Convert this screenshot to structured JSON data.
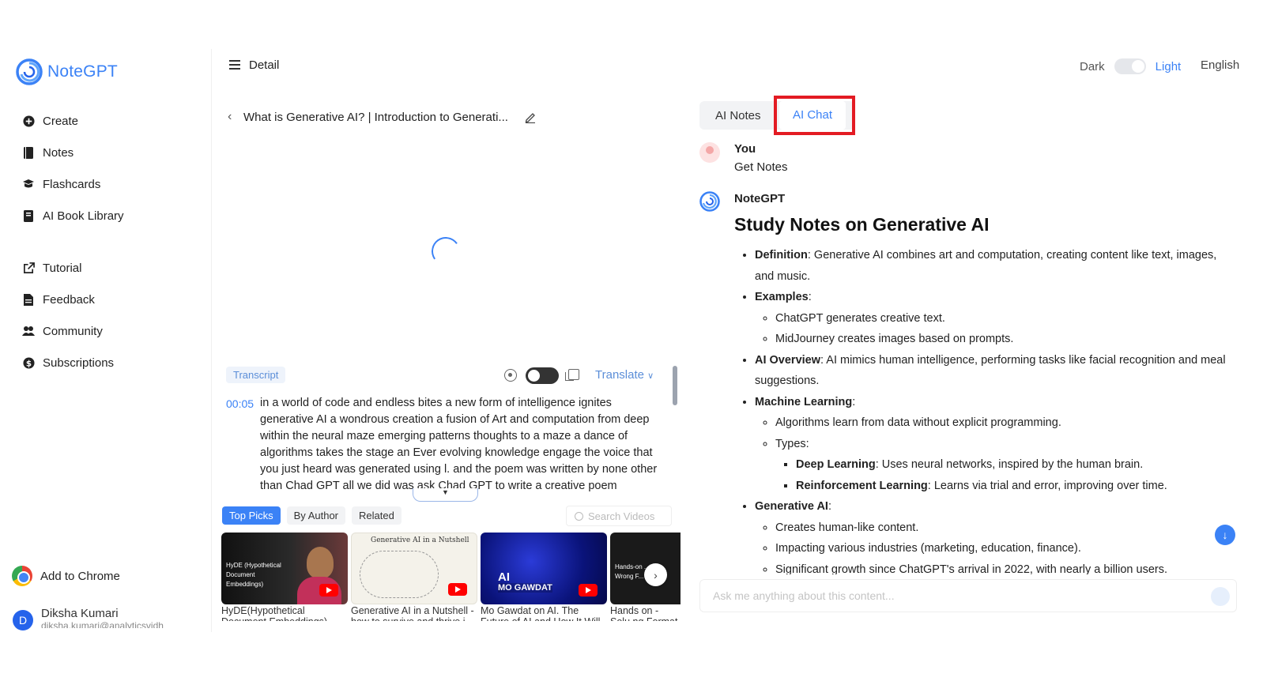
{
  "app": {
    "name": "NoteGPT"
  },
  "sidebar": {
    "primary": [
      {
        "label": "Create",
        "icon": "plus-circle-icon"
      },
      {
        "label": "Notes",
        "icon": "book-icon"
      },
      {
        "label": "Flashcards",
        "icon": "flashcards-icon"
      },
      {
        "label": "AI Book Library",
        "icon": "library-icon"
      }
    ],
    "secondary": [
      {
        "label": "Tutorial",
        "icon": "external-link-icon"
      },
      {
        "label": "Feedback",
        "icon": "document-icon"
      },
      {
        "label": "Community",
        "icon": "community-icon"
      },
      {
        "label": "Subscriptions",
        "icon": "dollar-icon"
      }
    ],
    "add_to_chrome": "Add to Chrome",
    "user": {
      "initial": "D",
      "name": "Diksha Kumari",
      "email": "diksha.kumari@analyticsvidh"
    }
  },
  "header": {
    "title": "Detail",
    "theme_dark": "Dark",
    "theme_light": "Light",
    "language": "English"
  },
  "video": {
    "title": "What is Generative AI? | Introduction to Generati...",
    "transcript_tab": "Transcript",
    "translate_label": "Translate",
    "transcript": {
      "timestamp": "00:05",
      "text": "in a world of code and endless bites a new form of intelligence ignites generative AI a wondrous creation a fusion of Art and computation from deep within the neural maze emerging patterns thoughts to a maze a dance of algorithms takes the stage an Ever evolving knowledge engage the voice that you just heard was generated using l. and the poem was written by none other than Chad GPT all we did was ask Chad GPT to write a creative poem"
    }
  },
  "recommendations": {
    "tabs": [
      "Top Picks",
      "By Author",
      "Related"
    ],
    "active_tab": "Top Picks",
    "search_placeholder": "Search Videos",
    "videos": [
      {
        "title": "HyDE(Hypothetical Document Embeddings)",
        "thumb_text": "HyDE (Hypothetical Document Embeddings)"
      },
      {
        "title": "Generative AI in a Nutshell - how to survive and thrive i...",
        "thumb_text": "Generative AI in a Nutshell"
      },
      {
        "title": "Mo Gawdat on AI. The Future of AI and How It Will Sh...",
        "thumb_text": "AI",
        "thumb_text2": "MO GAWDAT"
      },
      {
        "title": "Hands on - Solu ng Format",
        "thumb_text": "Hands-on ...tion Wrong F..."
      }
    ]
  },
  "chat": {
    "tabs": {
      "notes": "AI Notes",
      "chat": "AI Chat"
    },
    "active_tab": "AI Chat",
    "highlight_color": "#e31b23",
    "user_name": "You",
    "user_message": "Get Notes",
    "bot_name": "NoteGPT",
    "answer": {
      "heading": "Study Notes on Generative AI",
      "definition_label": "Definition",
      "definition_text": ": Generative AI combines art and computation, creating content like text, images, and music.",
      "examples_label": "Examples",
      "examples": [
        "ChatGPT generates creative text.",
        "MidJourney creates images based on prompts."
      ],
      "overview_label": "AI Overview",
      "overview_text": ": AI mimics human intelligence, performing tasks like facial recognition and meal suggestions.",
      "ml_label": "Machine Learning",
      "ml_point": "Algorithms learn from data without explicit programming.",
      "types_label": "Types:",
      "dl_label": "Deep Learning",
      "dl_text": ": Uses neural networks, inspired by the human brain.",
      "rl_label": "Reinforcement Learning",
      "rl_text": ": Learns via trial and error, improving over time.",
      "genai_label": "Generative AI",
      "genai_points": [
        "Creates human-like content.",
        "Impacting various industries (marketing, education, finance).",
        "Significant growth since ChatGPT's arrival in 2022, with nearly a billion users."
      ]
    },
    "input_placeholder": "Ask me anything about this content..."
  },
  "colors": {
    "accent": "#3b82f6",
    "highlight": "#e31b23"
  }
}
